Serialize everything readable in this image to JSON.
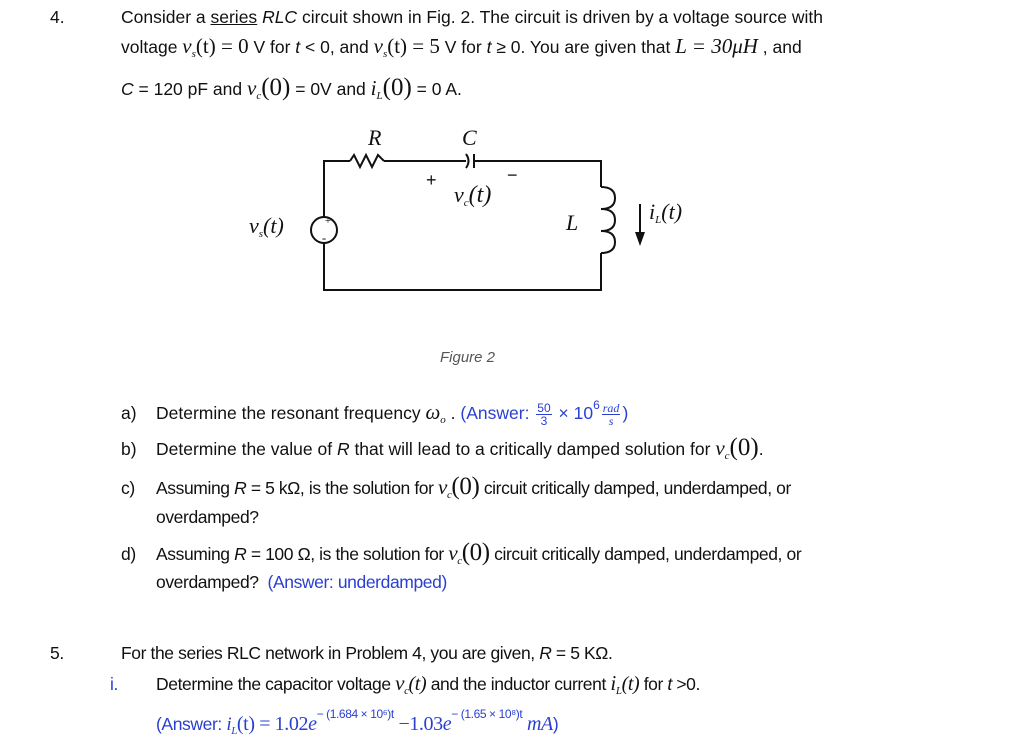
{
  "problem4": {
    "number": "4.",
    "line1": {
      "t1": "Consider a ",
      "series": "series",
      "t2": " ",
      "rlc": "RLC",
      "t3": " circuit shown in Fig. 2.  The circuit is driven by a voltage source with"
    },
    "line2": {
      "t1": "voltage ",
      "vs1": "v",
      "vs1_sub": "s",
      "eq1": "(t) = 0",
      "t2": " V for ",
      "tvar1": "t",
      "t3": " < 0, and ",
      "vs2": "v",
      "vs2_sub": "s",
      "eq2": "(t) = 5",
      "t4": " V for ",
      "tvar2": "t",
      "t5": " ≥  0.  You are given that ",
      "L_eq": "L = 30μH",
      "t6": " , and"
    },
    "line3": {
      "c_var": "C",
      "t1": " = 120 pF and ",
      "vc": "v",
      "vc_sub": "c",
      "vc_arg": "(0)",
      "t2": " = 0V and ",
      "il": "i",
      "il_sub": "L",
      "il_arg": "(0)",
      "t3": " = 0 A."
    },
    "figure": {
      "R_label": "R",
      "C_label": "C",
      "plus": "+",
      "minus": "−",
      "vc_label": "v",
      "vc_sub": "c",
      "vc_arg": "(t)",
      "vs_label": "v",
      "vs_sub": "s",
      "vs_arg": "(t)",
      "L_label": "L",
      "il_label": "i",
      "il_sub": "L",
      "il_arg": "(t)",
      "caption": "Figure 2"
    },
    "parts": [
      {
        "label": "a)",
        "text": "Determine the resonant frequency ",
        "omega": "ω",
        "omega_sub": "o",
        "after": " . ",
        "answer_prefix": "(Answer: ",
        "frac_num": "50",
        "frac_den": "3",
        "times": " × 10",
        "exp": "6",
        "unit_num": "rad",
        "unit_den": "s",
        "answer_suffix": ")"
      },
      {
        "label": "b)",
        "text": "Determine the value of ",
        "R": "R",
        "text2": " that will lead to a critically damped solution for ",
        "vc": "v",
        "vc_sub": "c",
        "vc_arg": "(0)",
        "end": "."
      },
      {
        "label": "c)",
        "text": "Assuming ",
        "R": "R",
        "text2": " = 5 kΩ, is the solution for ",
        "vc": "v",
        "vc_sub": "c",
        "vc_arg": "(0)",
        "text3": " circuit critically damped, underdamped, or",
        "line2": "overdamped?"
      },
      {
        "label": "d)",
        "text": "Assuming ",
        "R": "R",
        "text2": " = 100 Ω, is the solution for ",
        "vc": "v",
        "vc_sub": "c",
        "vc_arg": "(0)",
        "text3": " circuit critically damped, underdamped, or",
        "line2": "overdamped?  ",
        "answer": "(Answer: underdamped)"
      }
    ]
  },
  "problem5": {
    "number": "5.",
    "intro": {
      "t1": "For the series RLC network in Problem 4, you are given, ",
      "R": "R",
      "t2": " = 5 KΩ."
    },
    "item_i": {
      "label": "i.",
      "t1": "Determine the capacitor voltage ",
      "vc": "v",
      "vc_sub": "c",
      "vc_arg": "(t)",
      "t2": " and the inductor current ",
      "il": "i",
      "il_sub": "L",
      "il_arg": "(t)",
      "t3": " for ",
      "tvar": "t",
      "t4": " >0."
    },
    "answer": {
      "prefix": "(Answer: ",
      "il": "i",
      "il_sub": "L",
      "eq": "(t) = 1.02",
      "e1": "e",
      "exp1": "− (1.684 × 10⁶)t",
      "mid": " −1.03",
      "e2": "e",
      "exp2": "− (1.65 × 10⁸)t",
      "unit": " mA",
      "suffix": ")"
    }
  },
  "colors": {
    "answer": "#2a3fd0",
    "text": "#111111",
    "caption": "#555555"
  }
}
